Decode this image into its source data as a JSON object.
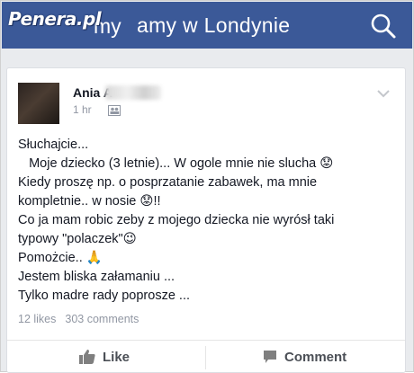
{
  "watermark": "Penera.pl",
  "header": {
    "title_partial": "amy w Londynie",
    "title_gap_fragment": "my",
    "search_icon": "search-icon",
    "background_color": "#3b5998"
  },
  "post": {
    "author": "Ania A",
    "timestamp": "1 hr",
    "audience_icon": "friends-icon",
    "lines": [
      "Słuchajcie...",
      "   Moje dziecko (3 letnie)... W ogole mnie nie slucha 😟",
      "Kiedy proszę np. o posprzatanie zabawek, ma mnie",
      "kompletnie.. w nosie 😟!!",
      "Co ja mam robic zeby z mojego dziecka nie wyrósł taki",
      "typowy \"polaczek\"😉",
      "Pomożcie.. 🙏",
      "Jestem bliska załamaniu ...",
      "Tylko madre rady poprosze ..."
    ],
    "likes": "12 likes",
    "comments": "303 comments"
  },
  "actions": {
    "like_label": "Like",
    "comment_label": "Comment"
  }
}
